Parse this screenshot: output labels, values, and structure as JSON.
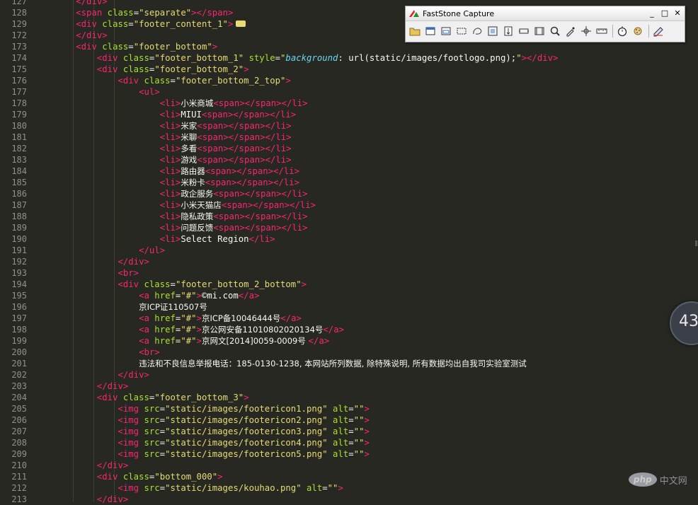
{
  "editor": {
    "line_numbers": [
      "127",
      "128",
      "129",
      "172",
      "173",
      "174",
      "175",
      "176",
      "177",
      "178",
      "179",
      "180",
      "181",
      "182",
      "183",
      "184",
      "185",
      "186",
      "187",
      "188",
      "189",
      "190",
      "191",
      "192",
      "193",
      "194",
      "195",
      "196",
      "197",
      "198",
      "199",
      "200",
      "201",
      "202",
      "203",
      "204",
      "205",
      "206",
      "207",
      "208",
      "209",
      "210",
      "211",
      "212",
      "213"
    ],
    "lines": [
      {
        "indent": 8,
        "tokens": [
          [
            "tag",
            "</"
          ],
          [
            "tag",
            "div"
          ],
          [
            "tag",
            ">"
          ]
        ]
      },
      {
        "indent": 8,
        "tokens": [
          [
            "tag",
            "<span"
          ],
          [
            "t",
            " "
          ],
          [
            "attr",
            "class"
          ],
          [
            "t",
            "="
          ],
          [
            "str",
            "\"separate\""
          ],
          [
            "tag",
            ">"
          ],
          [
            "tag",
            "</span>"
          ]
        ]
      },
      {
        "indent": 8,
        "tokens": [
          [
            "tag",
            "<div"
          ],
          [
            "t",
            " "
          ],
          [
            "attr",
            "class"
          ],
          [
            "t",
            "="
          ],
          [
            "str",
            "\"footer_content_1\""
          ],
          [
            "tag",
            ">"
          ]
        ],
        "folded": true
      },
      {
        "indent": 8,
        "tokens": [
          [
            "tag",
            "</div>"
          ]
        ]
      },
      {
        "indent": 8,
        "tokens": [
          [
            "tag",
            "<div"
          ],
          [
            "t",
            " "
          ],
          [
            "attr",
            "class"
          ],
          [
            "t",
            "="
          ],
          [
            "str",
            "\"footer_bottom\""
          ],
          [
            "tag",
            ">"
          ]
        ]
      },
      {
        "indent": 12,
        "tokens": [
          [
            "tag",
            "<div"
          ],
          [
            "t",
            " "
          ],
          [
            "attr",
            "class"
          ],
          [
            "t",
            "="
          ],
          [
            "str",
            "\"footer_bottom_1\""
          ],
          [
            "t",
            " "
          ],
          [
            "attr",
            "style"
          ],
          [
            "t",
            "="
          ],
          [
            "str",
            "\""
          ],
          [
            "kw",
            "background"
          ],
          [
            "t",
            ": "
          ],
          [
            "t",
            "url"
          ],
          [
            "t",
            "(static/images/footlogo.png);"
          ],
          [
            "str",
            "\""
          ],
          [
            "tag",
            ">"
          ],
          [
            "tag",
            "</div>"
          ]
        ]
      },
      {
        "indent": 12,
        "tokens": [
          [
            "tag",
            "<div"
          ],
          [
            "t",
            " "
          ],
          [
            "attr",
            "class"
          ],
          [
            "t",
            "="
          ],
          [
            "str",
            "\"footer_bottom_2\""
          ],
          [
            "tag",
            ">"
          ]
        ]
      },
      {
        "indent": 16,
        "tokens": [
          [
            "tag",
            "<div"
          ],
          [
            "t",
            " "
          ],
          [
            "attr",
            "class"
          ],
          [
            "t",
            "="
          ],
          [
            "str",
            "\"footer_bottom_2_top\""
          ],
          [
            "tag",
            ">"
          ]
        ]
      },
      {
        "indent": 20,
        "tokens": [
          [
            "tag",
            "<ul>"
          ]
        ]
      },
      {
        "indent": 24,
        "tokens": [
          [
            "tag",
            "<li>"
          ],
          [
            "c",
            "小米商城"
          ],
          [
            "tag",
            "<span>"
          ],
          [
            "tag",
            "</span>"
          ],
          [
            "tag",
            "</li>"
          ]
        ]
      },
      {
        "indent": 24,
        "tokens": [
          [
            "tag",
            "<li>"
          ],
          [
            "t",
            "MIUI"
          ],
          [
            "tag",
            "<span>"
          ],
          [
            "tag",
            "</span>"
          ],
          [
            "tag",
            "</li>"
          ]
        ]
      },
      {
        "indent": 24,
        "tokens": [
          [
            "tag",
            "<li>"
          ],
          [
            "c",
            "米家"
          ],
          [
            "tag",
            "<span>"
          ],
          [
            "tag",
            "</span>"
          ],
          [
            "tag",
            "</li>"
          ]
        ]
      },
      {
        "indent": 24,
        "tokens": [
          [
            "tag",
            "<li>"
          ],
          [
            "c",
            "米聊"
          ],
          [
            "tag",
            "<span>"
          ],
          [
            "tag",
            "</span>"
          ],
          [
            "tag",
            "</li>"
          ]
        ]
      },
      {
        "indent": 24,
        "tokens": [
          [
            "tag",
            "<li>"
          ],
          [
            "c",
            "多看"
          ],
          [
            "tag",
            "<span>"
          ],
          [
            "tag",
            "</span>"
          ],
          [
            "tag",
            "</li>"
          ]
        ]
      },
      {
        "indent": 24,
        "tokens": [
          [
            "tag",
            "<li>"
          ],
          [
            "c",
            "游戏"
          ],
          [
            "tag",
            "<span>"
          ],
          [
            "tag",
            "</span>"
          ],
          [
            "tag",
            "</li>"
          ]
        ]
      },
      {
        "indent": 24,
        "tokens": [
          [
            "tag",
            "<li>"
          ],
          [
            "c",
            "路由器"
          ],
          [
            "tag",
            "<span>"
          ],
          [
            "tag",
            "</span>"
          ],
          [
            "tag",
            "</li>"
          ]
        ]
      },
      {
        "indent": 24,
        "tokens": [
          [
            "tag",
            "<li>"
          ],
          [
            "c",
            "米粉卡"
          ],
          [
            "tag",
            "<span>"
          ],
          [
            "tag",
            "</span>"
          ],
          [
            "tag",
            "</li>"
          ]
        ]
      },
      {
        "indent": 24,
        "tokens": [
          [
            "tag",
            "<li>"
          ],
          [
            "c",
            "政企服务"
          ],
          [
            "tag",
            "<span>"
          ],
          [
            "tag",
            "</span>"
          ],
          [
            "tag",
            "</li>"
          ]
        ]
      },
      {
        "indent": 24,
        "tokens": [
          [
            "tag",
            "<li>"
          ],
          [
            "c",
            "小米天猫店"
          ],
          [
            "tag",
            "<span>"
          ],
          [
            "tag",
            "</span>"
          ],
          [
            "tag",
            "</li>"
          ]
        ]
      },
      {
        "indent": 24,
        "tokens": [
          [
            "tag",
            "<li>"
          ],
          [
            "c",
            "隐私政策"
          ],
          [
            "tag",
            "<span>"
          ],
          [
            "tag",
            "</span>"
          ],
          [
            "tag",
            "</li>"
          ]
        ]
      },
      {
        "indent": 24,
        "tokens": [
          [
            "tag",
            "<li>"
          ],
          [
            "c",
            "问题反馈"
          ],
          [
            "tag",
            "<span>"
          ],
          [
            "tag",
            "</span>"
          ],
          [
            "tag",
            "</li>"
          ]
        ]
      },
      {
        "indent": 24,
        "tokens": [
          [
            "tag",
            "<li>"
          ],
          [
            "t",
            "Select Region"
          ],
          [
            "tag",
            "</li>"
          ]
        ]
      },
      {
        "indent": 20,
        "tokens": [
          [
            "tag",
            "</ul>"
          ]
        ]
      },
      {
        "indent": 16,
        "tokens": [
          [
            "tag",
            "</div>"
          ]
        ]
      },
      {
        "indent": 16,
        "tokens": [
          [
            "tag",
            "<br>"
          ]
        ]
      },
      {
        "indent": 16,
        "tokens": [
          [
            "tag",
            "<div"
          ],
          [
            "t",
            " "
          ],
          [
            "attr",
            "class"
          ],
          [
            "t",
            "="
          ],
          [
            "str",
            "\"footer_bottom_2_bottom\""
          ],
          [
            "tag",
            ">"
          ]
        ]
      },
      {
        "indent": 20,
        "tokens": [
          [
            "tag",
            "<a"
          ],
          [
            "t",
            " "
          ],
          [
            "attr",
            "href"
          ],
          [
            "t",
            "="
          ],
          [
            "str",
            "\"#\""
          ],
          [
            "tag",
            ">"
          ],
          [
            "t",
            "©mi.com"
          ],
          [
            "tag",
            "</a>"
          ]
        ]
      },
      {
        "indent": 20,
        "tokens": [
          [
            "c",
            "京ICP证110507号"
          ]
        ]
      },
      {
        "indent": 20,
        "tokens": [
          [
            "tag",
            "<a"
          ],
          [
            "t",
            " "
          ],
          [
            "attr",
            "href"
          ],
          [
            "t",
            "="
          ],
          [
            "str",
            "\"#\""
          ],
          [
            "tag",
            ">"
          ],
          [
            "c",
            "京ICP备10046444号"
          ],
          [
            "tag",
            "</a>"
          ]
        ]
      },
      {
        "indent": 20,
        "tokens": [
          [
            "tag",
            "<a"
          ],
          [
            "t",
            " "
          ],
          [
            "attr",
            "href"
          ],
          [
            "t",
            "="
          ],
          [
            "str",
            "\"#\""
          ],
          [
            "tag",
            ">"
          ],
          [
            "c",
            "京公网安备11010802020134号"
          ],
          [
            "tag",
            "</a>"
          ]
        ]
      },
      {
        "indent": 20,
        "tokens": [
          [
            "tag",
            "<a"
          ],
          [
            "t",
            " "
          ],
          [
            "attr",
            "href"
          ],
          [
            "t",
            "="
          ],
          [
            "str",
            "\"#\""
          ],
          [
            "tag",
            ">"
          ],
          [
            "c",
            "京网文[2014]0059-0009号 "
          ],
          [
            "tag",
            "</a>"
          ]
        ]
      },
      {
        "indent": 20,
        "tokens": [
          [
            "tag",
            "<br>"
          ]
        ]
      },
      {
        "indent": 20,
        "tokens": [
          [
            "c",
            "违法和不良信息举报电话：185-0130-1238, 本网站所列数据, 除特殊说明, 所有数据均出自我司实验室测试"
          ]
        ]
      },
      {
        "indent": 16,
        "tokens": [
          [
            "tag",
            "</div>"
          ]
        ]
      },
      {
        "indent": 12,
        "tokens": [
          [
            "tag",
            "</div>"
          ]
        ]
      },
      {
        "indent": 12,
        "tokens": [
          [
            "tag",
            "<div"
          ],
          [
            "t",
            " "
          ],
          [
            "attr",
            "class"
          ],
          [
            "t",
            "="
          ],
          [
            "str",
            "\"footer_bottom_3\""
          ],
          [
            "tag",
            ">"
          ]
        ]
      },
      {
        "indent": 16,
        "tokens": [
          [
            "tag",
            "<img"
          ],
          [
            "t",
            " "
          ],
          [
            "attr",
            "src"
          ],
          [
            "t",
            "="
          ],
          [
            "str",
            "\"static/images/footericon1.png\""
          ],
          [
            "t",
            " "
          ],
          [
            "attr",
            "alt"
          ],
          [
            "t",
            "="
          ],
          [
            "str",
            "\"\""
          ],
          [
            "tag",
            ">"
          ]
        ]
      },
      {
        "indent": 16,
        "tokens": [
          [
            "tag",
            "<img"
          ],
          [
            "t",
            " "
          ],
          [
            "attr",
            "src"
          ],
          [
            "t",
            "="
          ],
          [
            "str",
            "\"static/images/footericon2.png\""
          ],
          [
            "t",
            " "
          ],
          [
            "attr",
            "alt"
          ],
          [
            "t",
            "="
          ],
          [
            "str",
            "\"\""
          ],
          [
            "tag",
            ">"
          ]
        ]
      },
      {
        "indent": 16,
        "tokens": [
          [
            "tag",
            "<img"
          ],
          [
            "t",
            " "
          ],
          [
            "attr",
            "src"
          ],
          [
            "t",
            "="
          ],
          [
            "str",
            "\"static/images/footericon3.png\""
          ],
          [
            "t",
            " "
          ],
          [
            "attr",
            "alt"
          ],
          [
            "t",
            "="
          ],
          [
            "str",
            "\"\""
          ],
          [
            "tag",
            ">"
          ]
        ]
      },
      {
        "indent": 16,
        "tokens": [
          [
            "tag",
            "<img"
          ],
          [
            "t",
            " "
          ],
          [
            "attr",
            "src"
          ],
          [
            "t",
            "="
          ],
          [
            "str",
            "\"static/images/footericon4.png\""
          ],
          [
            "t",
            " "
          ],
          [
            "attr",
            "alt"
          ],
          [
            "t",
            "="
          ],
          [
            "str",
            "\"\""
          ],
          [
            "tag",
            ">"
          ]
        ]
      },
      {
        "indent": 16,
        "tokens": [
          [
            "tag",
            "<img"
          ],
          [
            "t",
            " "
          ],
          [
            "attr",
            "src"
          ],
          [
            "t",
            "="
          ],
          [
            "str",
            "\"static/images/footericon5.png\""
          ],
          [
            "t",
            " "
          ],
          [
            "attr",
            "alt"
          ],
          [
            "t",
            "="
          ],
          [
            "str",
            "\"\""
          ],
          [
            "tag",
            ">"
          ]
        ]
      },
      {
        "indent": 12,
        "tokens": [
          [
            "tag",
            "</div>"
          ]
        ]
      },
      {
        "indent": 12,
        "tokens": [
          [
            "tag",
            "<div"
          ],
          [
            "t",
            " "
          ],
          [
            "attr",
            "class"
          ],
          [
            "t",
            "="
          ],
          [
            "str",
            "\"bottom_000\""
          ],
          [
            "tag",
            ">"
          ]
        ]
      },
      {
        "indent": 16,
        "tokens": [
          [
            "tag",
            "<img"
          ],
          [
            "t",
            " "
          ],
          [
            "attr",
            "src"
          ],
          [
            "t",
            "="
          ],
          [
            "str",
            "\"static/images/kouhao.png\""
          ],
          [
            "t",
            " "
          ],
          [
            "attr",
            "alt"
          ],
          [
            "t",
            "="
          ],
          [
            "str",
            "\"\""
          ],
          [
            "tag",
            ">"
          ]
        ]
      },
      {
        "indent": 12,
        "tokens": [
          [
            "tag",
            "</div>"
          ]
        ]
      }
    ]
  },
  "capture_toolbar": {
    "title": "FastStone Capture",
    "minimize": "_",
    "restore": "□",
    "close": "✕",
    "tools": [
      "open-folder-icon",
      "capture-active-window-icon",
      "capture-window-object-icon",
      "capture-rectangle-icon",
      "capture-freehand-icon",
      "capture-fullscreen-icon",
      "capture-scrolling-icon",
      "capture-fixed-region-icon",
      "capture-video-icon",
      "magnifier-icon",
      "color-picker-icon",
      "crosshair-icon",
      "ruler-icon",
      "timer-icon",
      "settings-icon",
      "output-icon"
    ]
  },
  "timer_widget": {
    "value": "43"
  },
  "watermark": {
    "logo": "php",
    "site": "中文网"
  },
  "colors": {
    "background": "#272822",
    "tag": "#f92672",
    "attribute": "#a6e22e",
    "string": "#e6db74",
    "text": "#f8f8f2",
    "line_number": "#8f908a"
  }
}
